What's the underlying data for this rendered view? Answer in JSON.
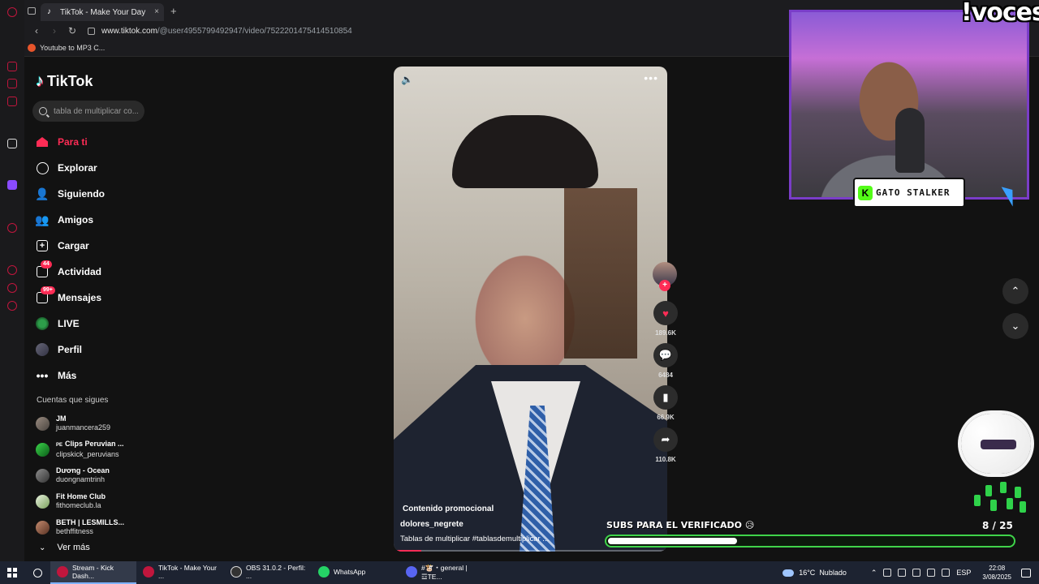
{
  "browser": {
    "tab_title": "TikTok - Make Your Day",
    "tab_close": "×",
    "new_tab": "+",
    "nav_back": "‹",
    "nav_forward": "›",
    "nav_reload": "↻",
    "url_host": "www.tiktok.com",
    "url_path": "/@user4955799492947/video/7522201475414510854",
    "bookmark_label": "Youtube to MP3 C..."
  },
  "tiktok": {
    "logo_text": "TikTok",
    "search_placeholder": "tabla de multiplicar co...",
    "nav": [
      {
        "label": "Para ti",
        "icon": "home-icon"
      },
      {
        "label": "Explorar",
        "icon": "compass-icon"
      },
      {
        "label": "Siguiendo",
        "icon": "following-icon"
      },
      {
        "label": "Amigos",
        "icon": "friends-icon"
      },
      {
        "label": "Cargar",
        "icon": "upload-icon"
      },
      {
        "label": "Actividad",
        "icon": "activity-icon",
        "badge": "44"
      },
      {
        "label": "Mensajes",
        "icon": "messages-icon",
        "badge": "99+"
      },
      {
        "label": "LIVE",
        "icon": "live-icon"
      },
      {
        "label": "Perfil",
        "icon": "profile-icon"
      },
      {
        "label": "Más",
        "icon": "more-icon"
      }
    ],
    "following_title": "Cuentas que sigues",
    "following": [
      {
        "name": "JM",
        "handle": "juanmancera259"
      },
      {
        "name": "Clips Peruvian ...",
        "handle": "clipskick_peruvians",
        "prefix": "PE"
      },
      {
        "name": "Dương - Ocean",
        "handle": "duongnamtrinh"
      },
      {
        "name": "Fit Home Club",
        "handle": "fithomeclub.la"
      },
      {
        "name": "BETH | LESMILLS...",
        "handle": "bethffitness"
      }
    ],
    "see_more": "Ver más",
    "video": {
      "promo": "Contenido promocional",
      "author": "dolores_negrete",
      "caption": "Tablas de multiplicar #tablasdemultiplicar ...",
      "progress": 0.1
    },
    "actions": {
      "likes": "189.6K",
      "comments": "6484",
      "saves": "66.9K",
      "shares": "110.8K"
    }
  },
  "overlay": {
    "voces_text": "!voces",
    "streamer_name": "GATO STALKER",
    "kick_letter": "K",
    "subs_label": "SUBS PARA EL VERIFICADO 😥",
    "subs_current": 8,
    "subs_goal": 25,
    "subs_count_text": "8 / 25"
  },
  "taskbar": {
    "items": [
      {
        "label": "Stream - Kick Dash...",
        "color": "#c0163d",
        "active": true
      },
      {
        "label": "TikTok - Make Your ...",
        "color": "#c0163d",
        "active": false
      },
      {
        "label": "OBS 31.0.2 - Perfil: ...",
        "color": "#333333",
        "active": false
      },
      {
        "label": "WhatsApp",
        "color": "#25d366",
        "active": false
      },
      {
        "label": "#🐮・general | ☲TE...",
        "color": "#5865f2",
        "active": false
      }
    ],
    "temperature": "16°C",
    "weather": "Nublado",
    "language": "ESP",
    "time": "22:08",
    "date": "3/08/2025"
  }
}
